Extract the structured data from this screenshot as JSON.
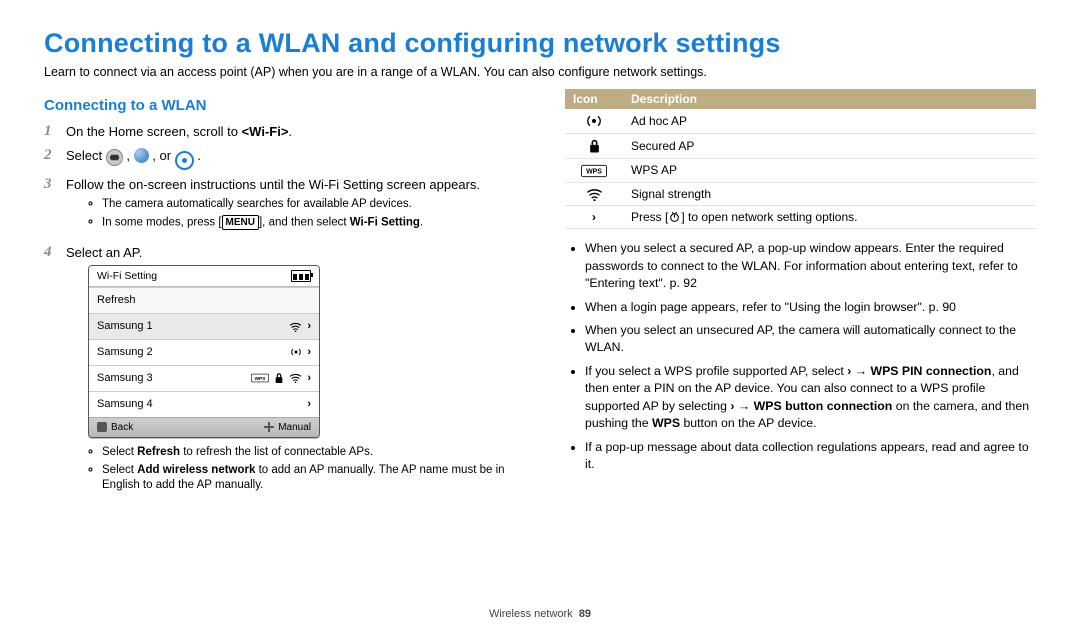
{
  "title": "Connecting to a WLAN and configuring network settings",
  "intro": "Learn to connect via an access point (AP) when you are in a range of a WLAN. You can also configure network settings.",
  "left": {
    "subheading": "Connecting to a WLAN",
    "step1_a": "On the Home screen, scroll to ",
    "step1_b": "<Wi-Fi>",
    "step1_c": ".",
    "step2_a": "Select ",
    "step2_b": ", ",
    "step2_c": ", or ",
    "step2_d": ".",
    "step3": "Follow the on-screen instructions until the Wi-Fi Setting screen appears.",
    "step3_b1": "The camera automatically searches for available AP devices.",
    "step3_b2_a": "In some modes, press [",
    "step3_b2_menu": "MENU",
    "step3_b2_b": "], and then select ",
    "step3_b2_bold": "Wi-Fi Setting",
    "step3_b2_c": ".",
    "step4": "Select an AP.",
    "panel": {
      "head": "Wi-Fi Setting",
      "refresh": "Refresh",
      "rows": [
        "Samsung 1",
        "Samsung 2",
        "Samsung 3",
        "Samsung 4"
      ],
      "foot_back": "Back",
      "foot_manual": "Manual"
    },
    "step4_b1_a": "Select ",
    "step4_b1_bold": "Refresh",
    "step4_b1_b": " to refresh the list of connectable APs.",
    "step4_b2_a": "Select ",
    "step4_b2_bold": "Add wireless network",
    "step4_b2_b": " to add an AP manually. The AP name must be in English to add the AP manually."
  },
  "right": {
    "th_icon": "Icon",
    "th_desc": "Description",
    "rows": {
      "adhoc": "Ad hoc AP",
      "secured": "Secured AP",
      "wps": "WPS AP",
      "signal": "Signal strength",
      "press_a": "Press [",
      "press_b": "] to open network setting options."
    },
    "b1": "When you select a secured AP, a pop-up window appears. Enter the required passwords to connect to the WLAN. For information about entering text, refer to \"Entering text\". p. 92",
    "b2": "When a login page appears, refer to \"Using the login browser\". p. 90",
    "b3": "When you select an unsecured AP, the camera will automatically connect to the WLAN.",
    "b4_a": "If you select a WPS profile supported AP, select ",
    "b4_arrow": " → ",
    "b4_bold1": "WPS PIN connection",
    "b4_b": ", and then enter a PIN on the AP device. You can also connect to a WPS profile supported AP by selecting ",
    "b4_bold2": "WPS button connection",
    "b4_c": " on the camera, and then pushing the ",
    "b4_bold3": "WPS",
    "b4_d": " button on the AP device.",
    "b5": "If a pop-up message about data collection regulations appears, read and agree to it."
  },
  "footer": {
    "section": "Wireless network",
    "page": "89"
  }
}
